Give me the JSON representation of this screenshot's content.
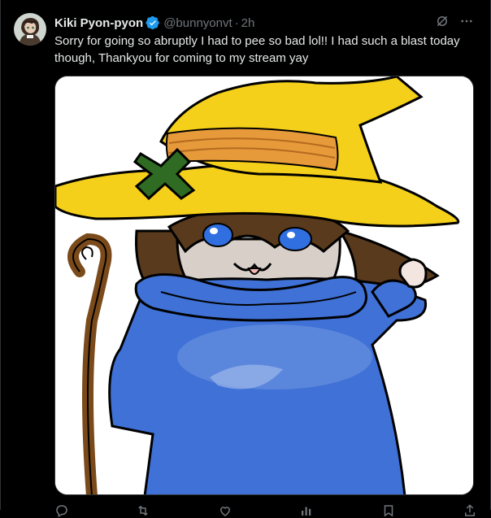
{
  "tweet": {
    "author_name": "Kiki Pyon-pyon",
    "handle": "@bunnyonvt",
    "separator": "·",
    "time": "2h",
    "text": "Sorry for going so abruptly I had to pee so bad lol!! I had such a blast today though, Thankyou for coming to my stream yay",
    "verified": true
  },
  "icons": {
    "verified": "verified-badge-icon",
    "grok": "grok-icon",
    "more": "more-icon",
    "reply": "reply-icon",
    "retweet": "retweet-icon",
    "like": "like-icon",
    "views": "views-icon",
    "bookmark": "bookmark-icon",
    "share": "share-icon"
  },
  "colors": {
    "background": "#000000",
    "text": "#e7e9ea",
    "secondary": "#71767b",
    "verified": "#1d9bf0",
    "border": "#2f3336"
  }
}
